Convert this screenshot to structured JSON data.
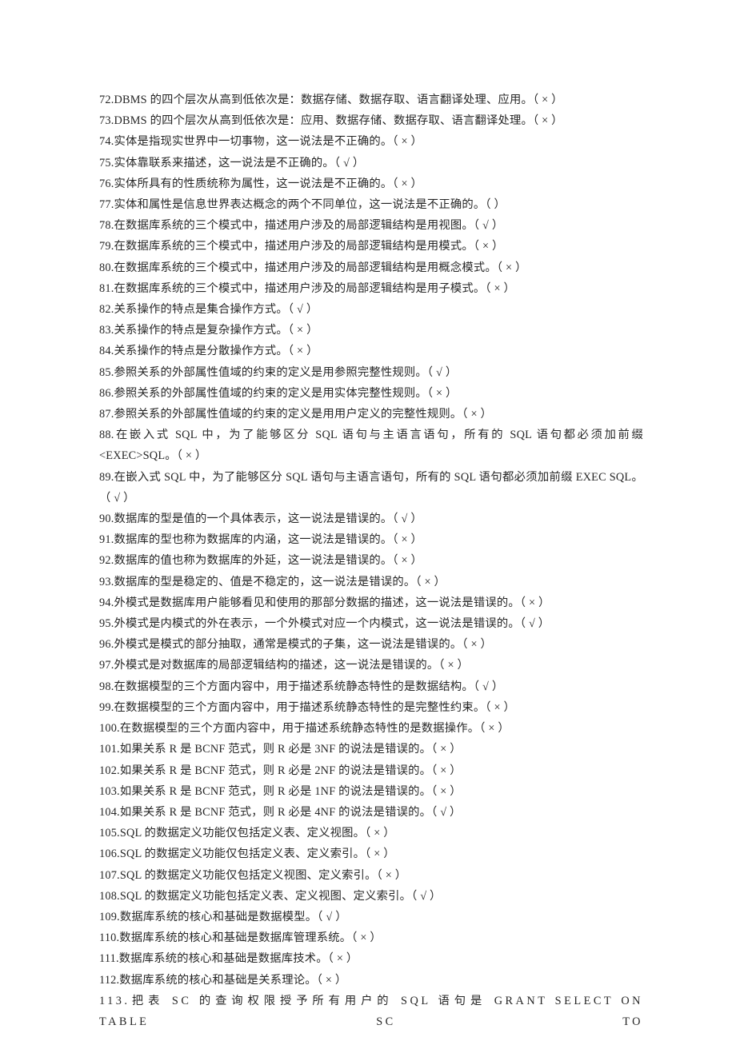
{
  "questions": [
    {
      "num": "72",
      "text": "DBMS 的四个层次从高到低依次是：数据存储、数据存取、语言翻译处理、应用。",
      "mark": "×"
    },
    {
      "num": "73",
      "text": "DBMS 的四个层次从高到低依次是：应用、数据存储、数据存取、语言翻译处理。",
      "mark": "×"
    },
    {
      "num": "74",
      "text": "实体是指现实世界中一切事物，这一说法是不正确的。",
      "mark": "×"
    },
    {
      "num": "75",
      "text": "实体靠联系来描述，这一说法是不正确的。",
      "mark": "√"
    },
    {
      "num": "76",
      "text": "实体所具有的性质统称为属性，这一说法是不正确的。",
      "mark": "×"
    },
    {
      "num": "77",
      "text": "实体和属性是信息世界表达概念的两个不同单位，这一说法是不正确的。",
      "mark": ""
    },
    {
      "num": "78",
      "text": "在数据库系统的三个模式中，描述用户涉及的局部逻辑结构是用视图。",
      "mark": "√"
    },
    {
      "num": "79",
      "text": "在数据库系统的三个模式中，描述用户涉及的局部逻辑结构是用模式。",
      "mark": "×"
    },
    {
      "num": "80",
      "text": "在数据库系统的三个模式中，描述用户涉及的局部逻辑结构是用概念模式。",
      "mark": "×"
    },
    {
      "num": "81",
      "text": "在数据库系统的三个模式中，描述用户涉及的局部逻辑结构是用子模式。",
      "mark": "×"
    },
    {
      "num": "82",
      "text": "关系操作的特点是集合操作方式。",
      "mark": "√"
    },
    {
      "num": "83",
      "text": "关系操作的特点是复杂操作方式。",
      "mark": "×"
    },
    {
      "num": "84",
      "text": "关系操作的特点是分散操作方式。",
      "mark": "×"
    },
    {
      "num": "85",
      "text": "参照关系的外部属性值域的约束的定义是用参照完整性规则。",
      "mark": "√"
    },
    {
      "num": "86",
      "text": "参照关系的外部属性值域的约束的定义是用实体完整性规则。",
      "mark": "×"
    },
    {
      "num": "87",
      "text": "参照关系的外部属性值域的约束的定义是用用户定义的完整性规则。",
      "mark": "×"
    },
    {
      "num": "88",
      "text": "在嵌入式 SQL 中，为了能够区分 SQL 语句与主语言语句，所有的 SQL 语句都必须加前缀 <EXEC>SQL。",
      "mark": "×"
    },
    {
      "num": "89",
      "text": "在嵌入式 SQL 中，为了能够区分 SQL 语句与主语言语句，所有的 SQL 语句都必须加前缀 EXEC SQL。",
      "mark": " √ "
    },
    {
      "num": "90",
      "text": "数据库的型是值的一个具体表示，这一说法是错误的。",
      "mark": "√"
    },
    {
      "num": "91",
      "text": "数据库的型也称为数据库的内涵，这一说法是错误的。",
      "mark": "×"
    },
    {
      "num": "92",
      "text": "数据库的值也称为数据库的外延，这一说法是错误的。",
      "mark": "×"
    },
    {
      "num": "93",
      "text": "数据库的型是稳定的、值是不稳定的，这一说法是错误的。",
      "mark": "×"
    },
    {
      "num": "94",
      "text": "外模式是数据库用户能够看见和使用的那部分数据的描述，这一说法是错误的。",
      "mark": "×"
    },
    {
      "num": "95",
      "text": "外模式是内模式的外在表示，一个外模式对应一个内模式，这一说法是错误的。",
      "mark": "√"
    },
    {
      "num": "96",
      "text": "外模式是模式的部分抽取，通常是模式的子集，这一说法是错误的。",
      "mark": "×"
    },
    {
      "num": "97",
      "text": "外模式是对数据库的局部逻辑结构的描述，这一说法是错误的。",
      "mark": "×"
    },
    {
      "num": "98",
      "text": "在数据模型的三个方面内容中，用于描述系统静态特性的是数据结构。",
      "mark": "√"
    },
    {
      "num": "99",
      "text": "在数据模型的三个方面内容中，用于描述系统静态特性的是完整性约束。",
      "mark": "×"
    },
    {
      "num": "100",
      "text": "在数据模型的三个方面内容中，用于描述系统静态特性的是数据操作。",
      "mark": "×"
    },
    {
      "num": "101",
      "text": "如果关系 R 是 BCNF 范式，则 R 必是 3NF 的说法是错误的。",
      "mark": "×"
    },
    {
      "num": "102",
      "text": "如果关系 R 是 BCNF 范式，则 R 必是 2NF 的说法是错误的。",
      "mark": "×"
    },
    {
      "num": "103",
      "text": "如果关系 R 是 BCNF 范式，则 R 必是 1NF 的说法是错误的。",
      "mark": "×"
    },
    {
      "num": "104",
      "text": "如果关系 R 是 BCNF 范式，则 R 必是 4NF 的说法是错误的。",
      "mark": "√"
    },
    {
      "num": "105",
      "text": "SQL 的数据定义功能仅包括定义表、定义视图。",
      "mark": "×"
    },
    {
      "num": "106",
      "text": "SQL 的数据定义功能仅包括定义表、定义索引。",
      "mark": "×"
    },
    {
      "num": "107",
      "text": "SQL 的数据定义功能仅包括定义视图、定义索引。",
      "mark": "×"
    },
    {
      "num": "108",
      "text": "SQL 的数据定义功能包括定义表、定义视图、定义索引。",
      "mark": "√"
    },
    {
      "num": "109",
      "text": "数据库系统的核心和基础是数据模型。",
      "mark": "√"
    },
    {
      "num": "110",
      "text": "数据库系统的核心和基础是数据库管理系统。",
      "mark": "×"
    },
    {
      "num": "111",
      "text": "数据库系统的核心和基础是数据库技术。",
      "mark": "×"
    },
    {
      "num": "112",
      "text": "数据库系统的核心和基础是关系理论。",
      "mark": "×"
    },
    {
      "num": "113",
      "text": "把表 SC 的查询权限授予所有用户的 SQL 语句是 GRANT SELECT ON TABLE SC TO",
      "mark": null
    }
  ]
}
